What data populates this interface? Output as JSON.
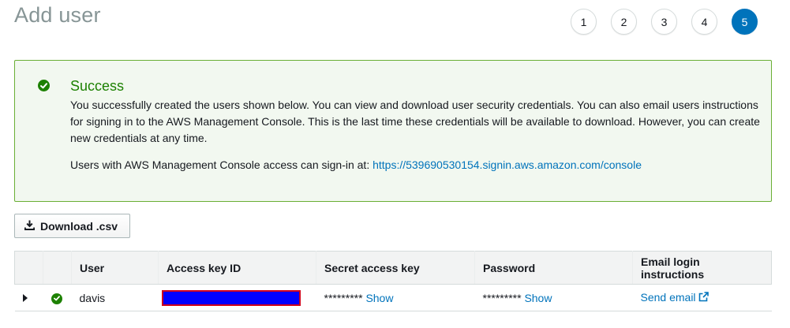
{
  "page": {
    "title": "Add user"
  },
  "steps": [
    "1",
    "2",
    "3",
    "4",
    "5"
  ],
  "active_step": "5",
  "success": {
    "title": "Success",
    "body": "You successfully created the users shown below. You can view and download user security credentials. You can also email users instructions for signing in to the AWS Management Console. This is the last time these credentials will be available to download. However, you can create new credentials at any time.",
    "signin_prefix": "Users with AWS Management Console access can sign-in at:",
    "signin_url": "https://539690530154.signin.aws.amazon.com/console"
  },
  "download_button": {
    "label": "Download .csv",
    "icon": "download-icon"
  },
  "table": {
    "headers": {
      "user": "User",
      "access_key_id": "Access key ID",
      "secret_access_key": "Secret access key",
      "password": "Password",
      "email_login": "Email login instructions"
    },
    "rows": [
      {
        "user": "davis",
        "access_key_id": "",
        "secret_mask": "*********",
        "secret_show": "Show",
        "password_mask": "*********",
        "password_show": "Show",
        "email_link": "Send email"
      }
    ]
  },
  "colors": {
    "accent": "#0073bb",
    "success": "#1d8102",
    "redaction_fill": "#0000ff",
    "redaction_border": "#d0021b"
  }
}
